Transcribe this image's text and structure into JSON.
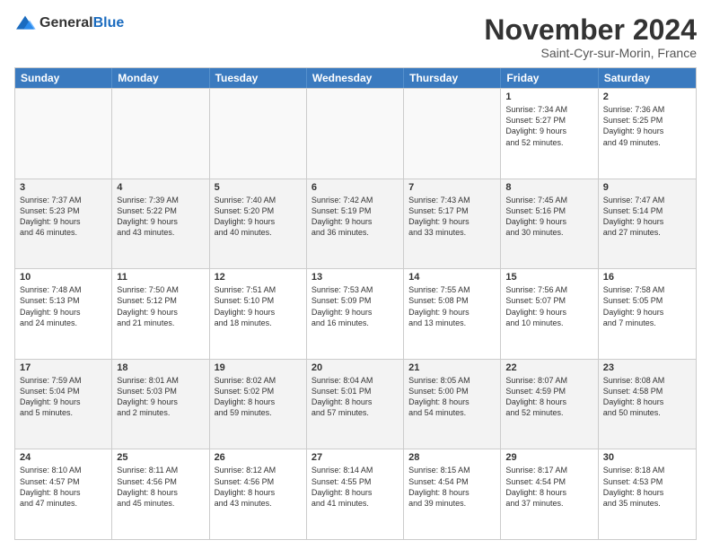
{
  "logo": {
    "general": "General",
    "blue": "Blue"
  },
  "title": "November 2024",
  "location": "Saint-Cyr-sur-Morin, France",
  "headers": [
    "Sunday",
    "Monday",
    "Tuesday",
    "Wednesday",
    "Thursday",
    "Friday",
    "Saturday"
  ],
  "rows": [
    [
      {
        "day": "",
        "empty": true
      },
      {
        "day": "",
        "empty": true
      },
      {
        "day": "",
        "empty": true
      },
      {
        "day": "",
        "empty": true
      },
      {
        "day": "",
        "empty": true
      },
      {
        "day": "1",
        "lines": [
          "Sunrise: 7:34 AM",
          "Sunset: 5:27 PM",
          "Daylight: 9 hours",
          "and 52 minutes."
        ]
      },
      {
        "day": "2",
        "lines": [
          "Sunrise: 7:36 AM",
          "Sunset: 5:25 PM",
          "Daylight: 9 hours",
          "and 49 minutes."
        ]
      }
    ],
    [
      {
        "day": "3",
        "lines": [
          "Sunrise: 7:37 AM",
          "Sunset: 5:23 PM",
          "Daylight: 9 hours",
          "and 46 minutes."
        ]
      },
      {
        "day": "4",
        "lines": [
          "Sunrise: 7:39 AM",
          "Sunset: 5:22 PM",
          "Daylight: 9 hours",
          "and 43 minutes."
        ]
      },
      {
        "day": "5",
        "lines": [
          "Sunrise: 7:40 AM",
          "Sunset: 5:20 PM",
          "Daylight: 9 hours",
          "and 40 minutes."
        ]
      },
      {
        "day": "6",
        "lines": [
          "Sunrise: 7:42 AM",
          "Sunset: 5:19 PM",
          "Daylight: 9 hours",
          "and 36 minutes."
        ]
      },
      {
        "day": "7",
        "lines": [
          "Sunrise: 7:43 AM",
          "Sunset: 5:17 PM",
          "Daylight: 9 hours",
          "and 33 minutes."
        ]
      },
      {
        "day": "8",
        "lines": [
          "Sunrise: 7:45 AM",
          "Sunset: 5:16 PM",
          "Daylight: 9 hours",
          "and 30 minutes."
        ]
      },
      {
        "day": "9",
        "lines": [
          "Sunrise: 7:47 AM",
          "Sunset: 5:14 PM",
          "Daylight: 9 hours",
          "and 27 minutes."
        ]
      }
    ],
    [
      {
        "day": "10",
        "lines": [
          "Sunrise: 7:48 AM",
          "Sunset: 5:13 PM",
          "Daylight: 9 hours",
          "and 24 minutes."
        ]
      },
      {
        "day": "11",
        "lines": [
          "Sunrise: 7:50 AM",
          "Sunset: 5:12 PM",
          "Daylight: 9 hours",
          "and 21 minutes."
        ]
      },
      {
        "day": "12",
        "lines": [
          "Sunrise: 7:51 AM",
          "Sunset: 5:10 PM",
          "Daylight: 9 hours",
          "and 18 minutes."
        ]
      },
      {
        "day": "13",
        "lines": [
          "Sunrise: 7:53 AM",
          "Sunset: 5:09 PM",
          "Daylight: 9 hours",
          "and 16 minutes."
        ]
      },
      {
        "day": "14",
        "lines": [
          "Sunrise: 7:55 AM",
          "Sunset: 5:08 PM",
          "Daylight: 9 hours",
          "and 13 minutes."
        ]
      },
      {
        "day": "15",
        "lines": [
          "Sunrise: 7:56 AM",
          "Sunset: 5:07 PM",
          "Daylight: 9 hours",
          "and 10 minutes."
        ]
      },
      {
        "day": "16",
        "lines": [
          "Sunrise: 7:58 AM",
          "Sunset: 5:05 PM",
          "Daylight: 9 hours",
          "and 7 minutes."
        ]
      }
    ],
    [
      {
        "day": "17",
        "lines": [
          "Sunrise: 7:59 AM",
          "Sunset: 5:04 PM",
          "Daylight: 9 hours",
          "and 5 minutes."
        ]
      },
      {
        "day": "18",
        "lines": [
          "Sunrise: 8:01 AM",
          "Sunset: 5:03 PM",
          "Daylight: 9 hours",
          "and 2 minutes."
        ]
      },
      {
        "day": "19",
        "lines": [
          "Sunrise: 8:02 AM",
          "Sunset: 5:02 PM",
          "Daylight: 8 hours",
          "and 59 minutes."
        ]
      },
      {
        "day": "20",
        "lines": [
          "Sunrise: 8:04 AM",
          "Sunset: 5:01 PM",
          "Daylight: 8 hours",
          "and 57 minutes."
        ]
      },
      {
        "day": "21",
        "lines": [
          "Sunrise: 8:05 AM",
          "Sunset: 5:00 PM",
          "Daylight: 8 hours",
          "and 54 minutes."
        ]
      },
      {
        "day": "22",
        "lines": [
          "Sunrise: 8:07 AM",
          "Sunset: 4:59 PM",
          "Daylight: 8 hours",
          "and 52 minutes."
        ]
      },
      {
        "day": "23",
        "lines": [
          "Sunrise: 8:08 AM",
          "Sunset: 4:58 PM",
          "Daylight: 8 hours",
          "and 50 minutes."
        ]
      }
    ],
    [
      {
        "day": "24",
        "lines": [
          "Sunrise: 8:10 AM",
          "Sunset: 4:57 PM",
          "Daylight: 8 hours",
          "and 47 minutes."
        ]
      },
      {
        "day": "25",
        "lines": [
          "Sunrise: 8:11 AM",
          "Sunset: 4:56 PM",
          "Daylight: 8 hours",
          "and 45 minutes."
        ]
      },
      {
        "day": "26",
        "lines": [
          "Sunrise: 8:12 AM",
          "Sunset: 4:56 PM",
          "Daylight: 8 hours",
          "and 43 minutes."
        ]
      },
      {
        "day": "27",
        "lines": [
          "Sunrise: 8:14 AM",
          "Sunset: 4:55 PM",
          "Daylight: 8 hours",
          "and 41 minutes."
        ]
      },
      {
        "day": "28",
        "lines": [
          "Sunrise: 8:15 AM",
          "Sunset: 4:54 PM",
          "Daylight: 8 hours",
          "and 39 minutes."
        ]
      },
      {
        "day": "29",
        "lines": [
          "Sunrise: 8:17 AM",
          "Sunset: 4:54 PM",
          "Daylight: 8 hours",
          "and 37 minutes."
        ]
      },
      {
        "day": "30",
        "lines": [
          "Sunrise: 8:18 AM",
          "Sunset: 4:53 PM",
          "Daylight: 8 hours",
          "and 35 minutes."
        ]
      }
    ]
  ]
}
